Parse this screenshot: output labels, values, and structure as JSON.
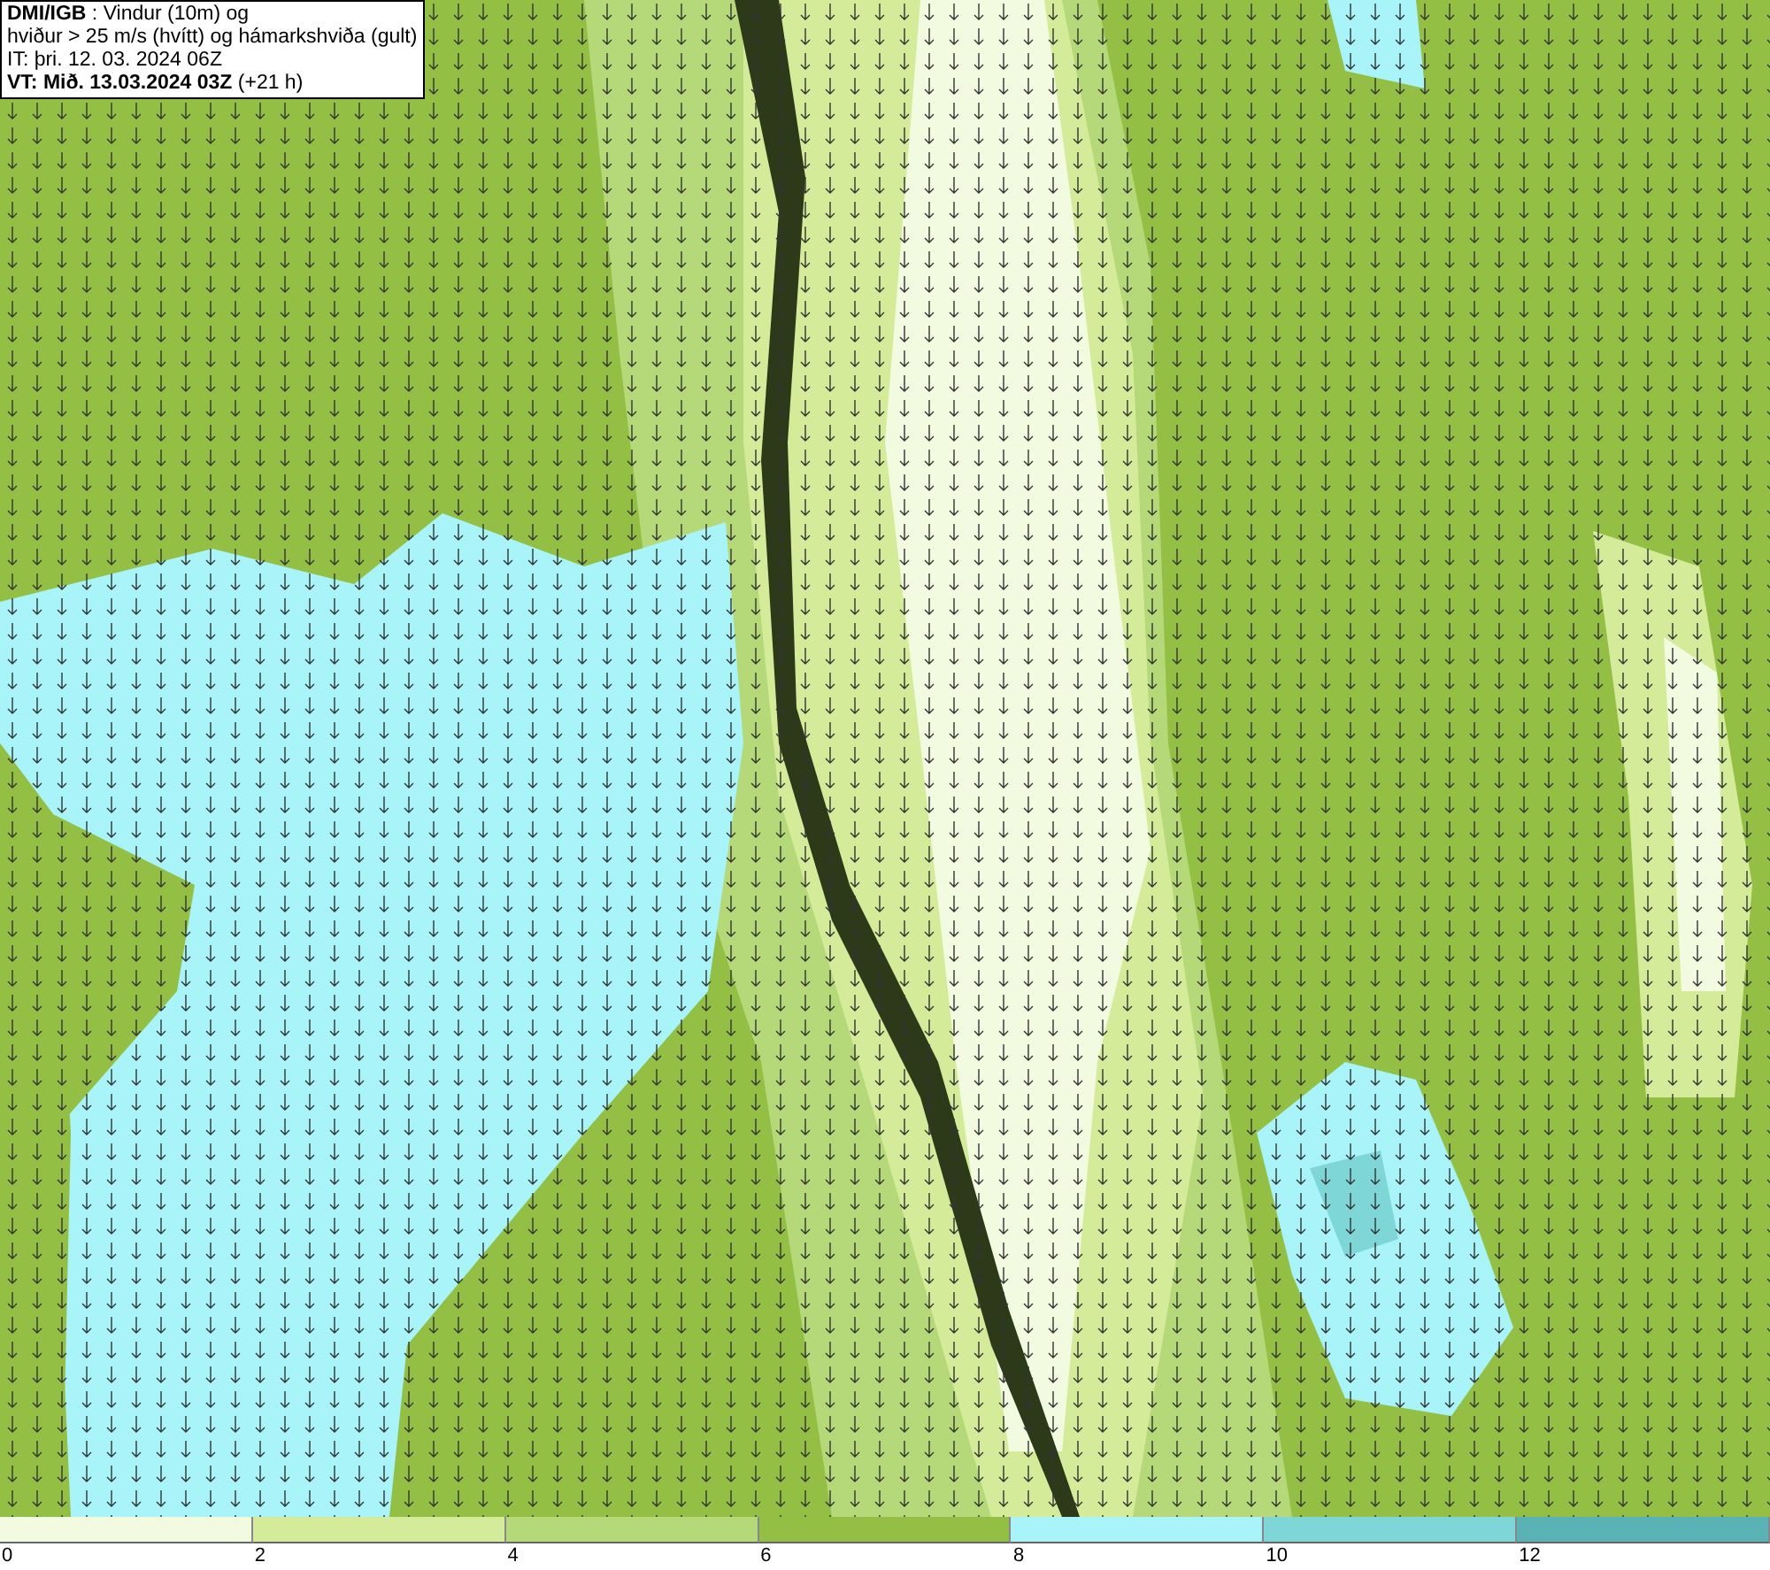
{
  "title_box": {
    "lines": [
      "**DMI/IGB** : Vindur (10m) og",
      "hviður > 25 m/s (hvítt) og hámarkshviða (gult)",
      "IT: þri. 12. 03. 2024 06Z",
      "**VT: Mið. 13.03.2024 03Z** (+21 h)"
    ]
  },
  "legend": [
    {
      "label": "0",
      "color": "#f2fbe0"
    },
    {
      "label": "2",
      "color": "#d4ec9a"
    },
    {
      "label": "4",
      "color": "#b5d978"
    },
    {
      "label": "6",
      "color": "#94bf45"
    },
    {
      "label": "8",
      "color": "#a8f4f8"
    },
    {
      "label": "10",
      "color": "#7fd6d6"
    },
    {
      "label": "12",
      "color": "#59b3b5"
    }
  ]
}
